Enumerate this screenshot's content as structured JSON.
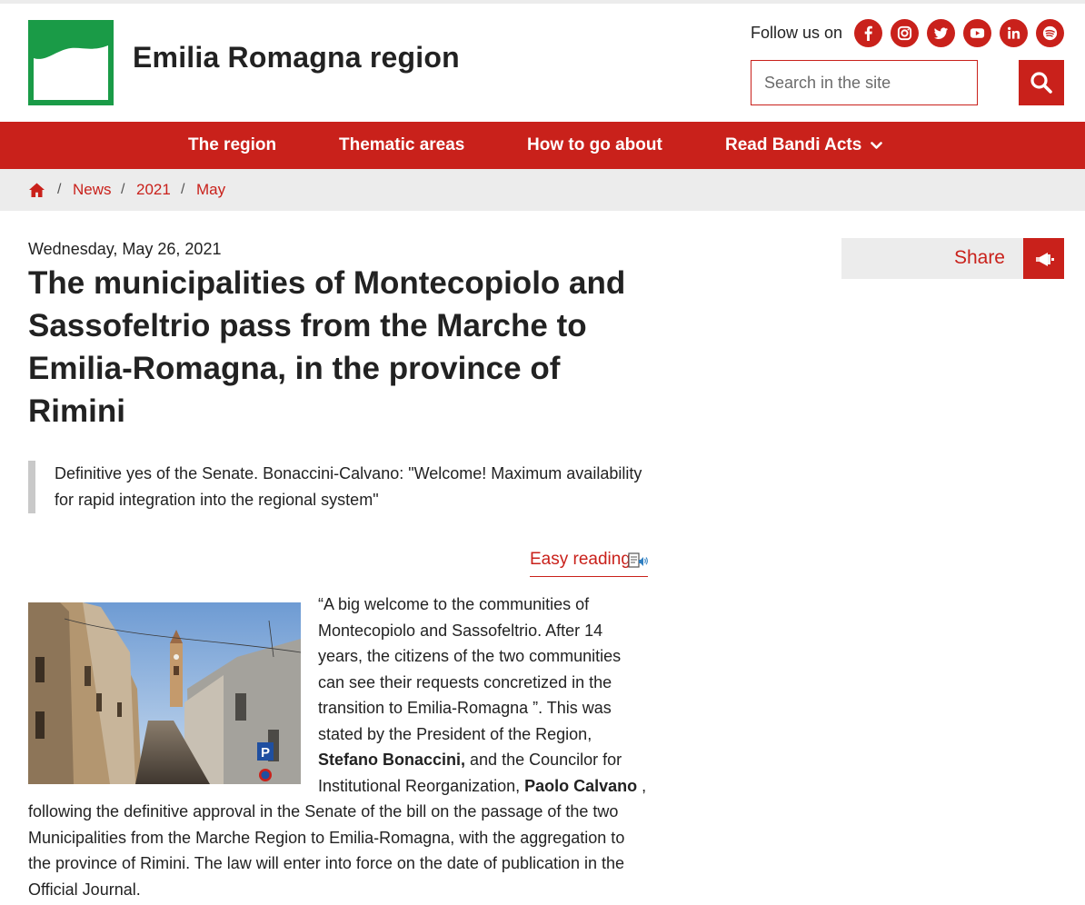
{
  "header": {
    "site_name": "Emilia Romagna region",
    "follow_label": "Follow us on",
    "social": [
      "facebook-icon",
      "instagram-icon",
      "twitter-icon",
      "youtube-icon",
      "linkedin-icon",
      "spotify-icon"
    ],
    "search_placeholder": "Search in the site"
  },
  "nav": {
    "items": [
      {
        "label": "The region"
      },
      {
        "label": "Thematic areas"
      },
      {
        "label": "How to go about"
      },
      {
        "label": "Read Bandi Acts"
      }
    ]
  },
  "breadcrumb": {
    "items": [
      {
        "label": "News"
      },
      {
        "label": "2021"
      },
      {
        "label": "May"
      }
    ],
    "separator": "/"
  },
  "article": {
    "date": "Wednesday, May 26, 2021",
    "title": "The municipalities of Montecopiolo and Sassofeltrio pass from the Marche to Emilia-Romagna, in the province of Rimini",
    "lead": "Definitive yes of the Senate. Bonaccini-Calvano: \"Welcome! Maximum availability for rapid integration into the regional system\"",
    "easy_reading": "Easy reading",
    "body_1": "“A big welcome to the communities of Montecopiolo and Sassofeltrio. After 14 years, the citizens of the two communities can see their requests concretized in the transition to Emilia-Romagna ”. This was stated by the President of the Region, ",
    "name_1": "Stefano Bonaccini,",
    "body_2": " and the Councilor for Institutional Reorganization, ",
    "name_2": "Paolo Calvano",
    "body_3": " , following the definitive approval in the Senate of the bill on the passage of the two Municipalities from the Marche Region to Emilia-Romagna, with the aggregation to the province of Rimini. The law will enter into force on the date of publication in the Official Journal."
  },
  "share": {
    "label": "Share"
  },
  "colors": {
    "brand_red": "#c9211b",
    "logo_green": "#1a9b47",
    "light_gray": "#ececec"
  }
}
